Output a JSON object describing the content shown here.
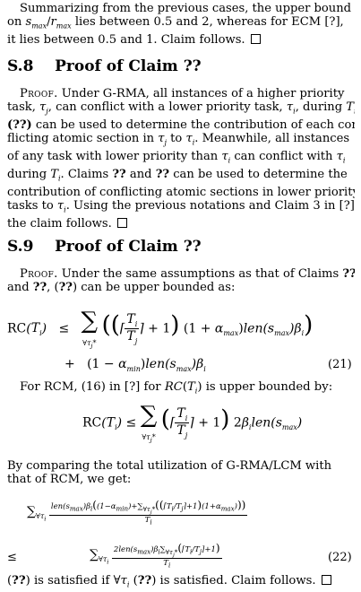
{
  "intro_lines": [
    "Summarizing from the previous cases, the upper bound",
    "on s_max/r_max lies between 0.5 and 2, whereas for ECM [?],",
    "it lies between 0.5 and 1. Claim follows."
  ],
  "section_s8": {
    "number": "S.8",
    "title": "Proof of Claim ??"
  },
  "s8_lines": [
    "Proof. Under G-RMA, all instances of a higher priority",
    "task, τj, can conflict with a lower priority task, τi, during Ti.",
    "(??) can be used to determine the contribution of each con-",
    "flicting atomic section in τj to τi. Meanwhile, all instances",
    "of any task with lower priority than τi can conflict with τi",
    "during Ti. Claims ?? and ?? can be used to determine the",
    "contribution of conflicting atomic sections in lower priority",
    "tasks to τi. Using the previous notations and Claim 3 in [?],",
    "the claim follows."
  ],
  "section_s9": {
    "number": "S.9",
    "title": "Proof of Claim ??"
  },
  "s9_lines": [
    "Proof. Under the same assumptions as that of Claims ??",
    "and ??, (??) can be upper bounded as:"
  ],
  "eq21": {
    "number": "(21)"
  },
  "rcm_line": "For RCM, (16) in [?] for RC(Ti) is upper bounded by:",
  "compare_lines": [
    "By comparing the total utilization of G-RMA/LCM with",
    "that of RCM, we get:"
  ],
  "eq22": {
    "number": "(22)"
  },
  "final_line": "(??) is satisfied if ∀τi (??) is satisfied. Claim follows."
}
